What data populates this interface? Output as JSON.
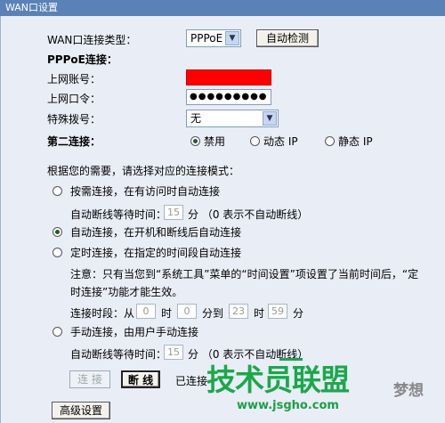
{
  "window": {
    "title": "WAN口设置"
  },
  "wan": {
    "type_label": "WAN口连接类型：",
    "type_value": "PPPoE",
    "detect_button": "自动检测"
  },
  "pppoe": {
    "section_label": "PPPoE连接：",
    "account_label": "上网账号：",
    "account_value": "",
    "password_label": "上网口令：",
    "password_value": "●●●●●●●●●",
    "dial_label": "特殊拨号：",
    "dial_value": "无"
  },
  "second": {
    "label": "第二连接：",
    "options": [
      "禁用",
      "动态 IP",
      "静态 IP"
    ],
    "selected": "禁用"
  },
  "mode": {
    "intro": "根据您的需要，请选择对应的连接模式：",
    "on_demand_label": "按需连接，在有访问时自动连接",
    "on_demand_wait_label": "自动断线等待时间：",
    "on_demand_wait_value": "15",
    "on_demand_wait_unit": "分 （0 表示不自动断线）",
    "auto_label": "自动连接，在开机和断线后自动连接",
    "timed_label": "定时连接，在指定的时间段自动连接",
    "timed_note_line1": "注意：只有当您到“系统工具”菜单的“时间设置”项设置了当前时间后，“定",
    "timed_note_line2": "时连接”功能才能生效。",
    "period_label": "连接时段：从",
    "from_hour": "0",
    "hour_unit1": "时",
    "from_min": "0",
    "min_unit_to": "分到",
    "to_hour": "23",
    "hour_unit2": "时",
    "to_min": "59",
    "min_unit2": "分",
    "manual_label": "手动连接，由用户手动连接",
    "manual_wait_label": "自动断线等待时间：",
    "manual_wait_value": "15",
    "manual_wait_unit": "分 （0 表示不自动断线）",
    "selected": "auto"
  },
  "actions": {
    "connect_button": "连 接",
    "disconnect_button": "断 线",
    "status": "已连接",
    "advanced_button": "高级设置"
  },
  "watermark": {
    "text": "技术员联盟",
    "url": "www.jsgho.com",
    "side": "梦想"
  }
}
